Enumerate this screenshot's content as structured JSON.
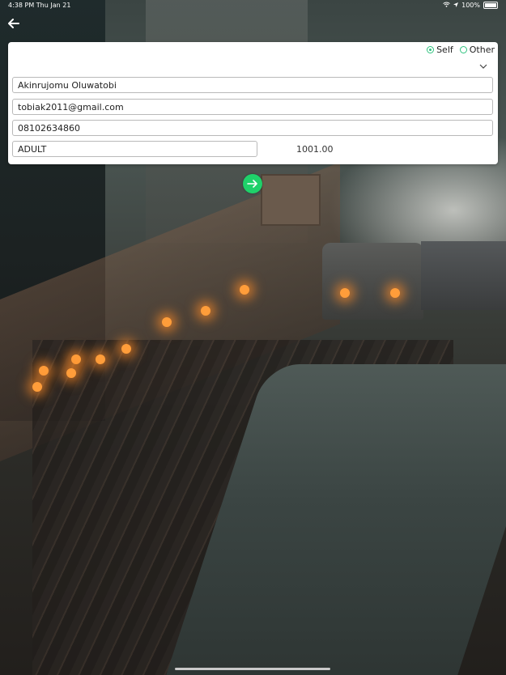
{
  "status_bar": {
    "time": "4:38 PM  Thu Jan 21",
    "battery": "100%"
  },
  "form": {
    "radio_self": "Self",
    "radio_other": "Other",
    "selected": "Self",
    "name": "Akinrujomu Oluwatobi",
    "email": "tobiak2011@gmail.com",
    "phone": "08102634860",
    "category": "ADULT",
    "amount": "1001.00"
  },
  "colors": {
    "accent": "#1fd16a",
    "radio": "#2ec27e"
  },
  "icons": {
    "back": "arrow-left-icon",
    "dropdown": "chevron-down-icon",
    "next": "arrow-right-icon"
  }
}
